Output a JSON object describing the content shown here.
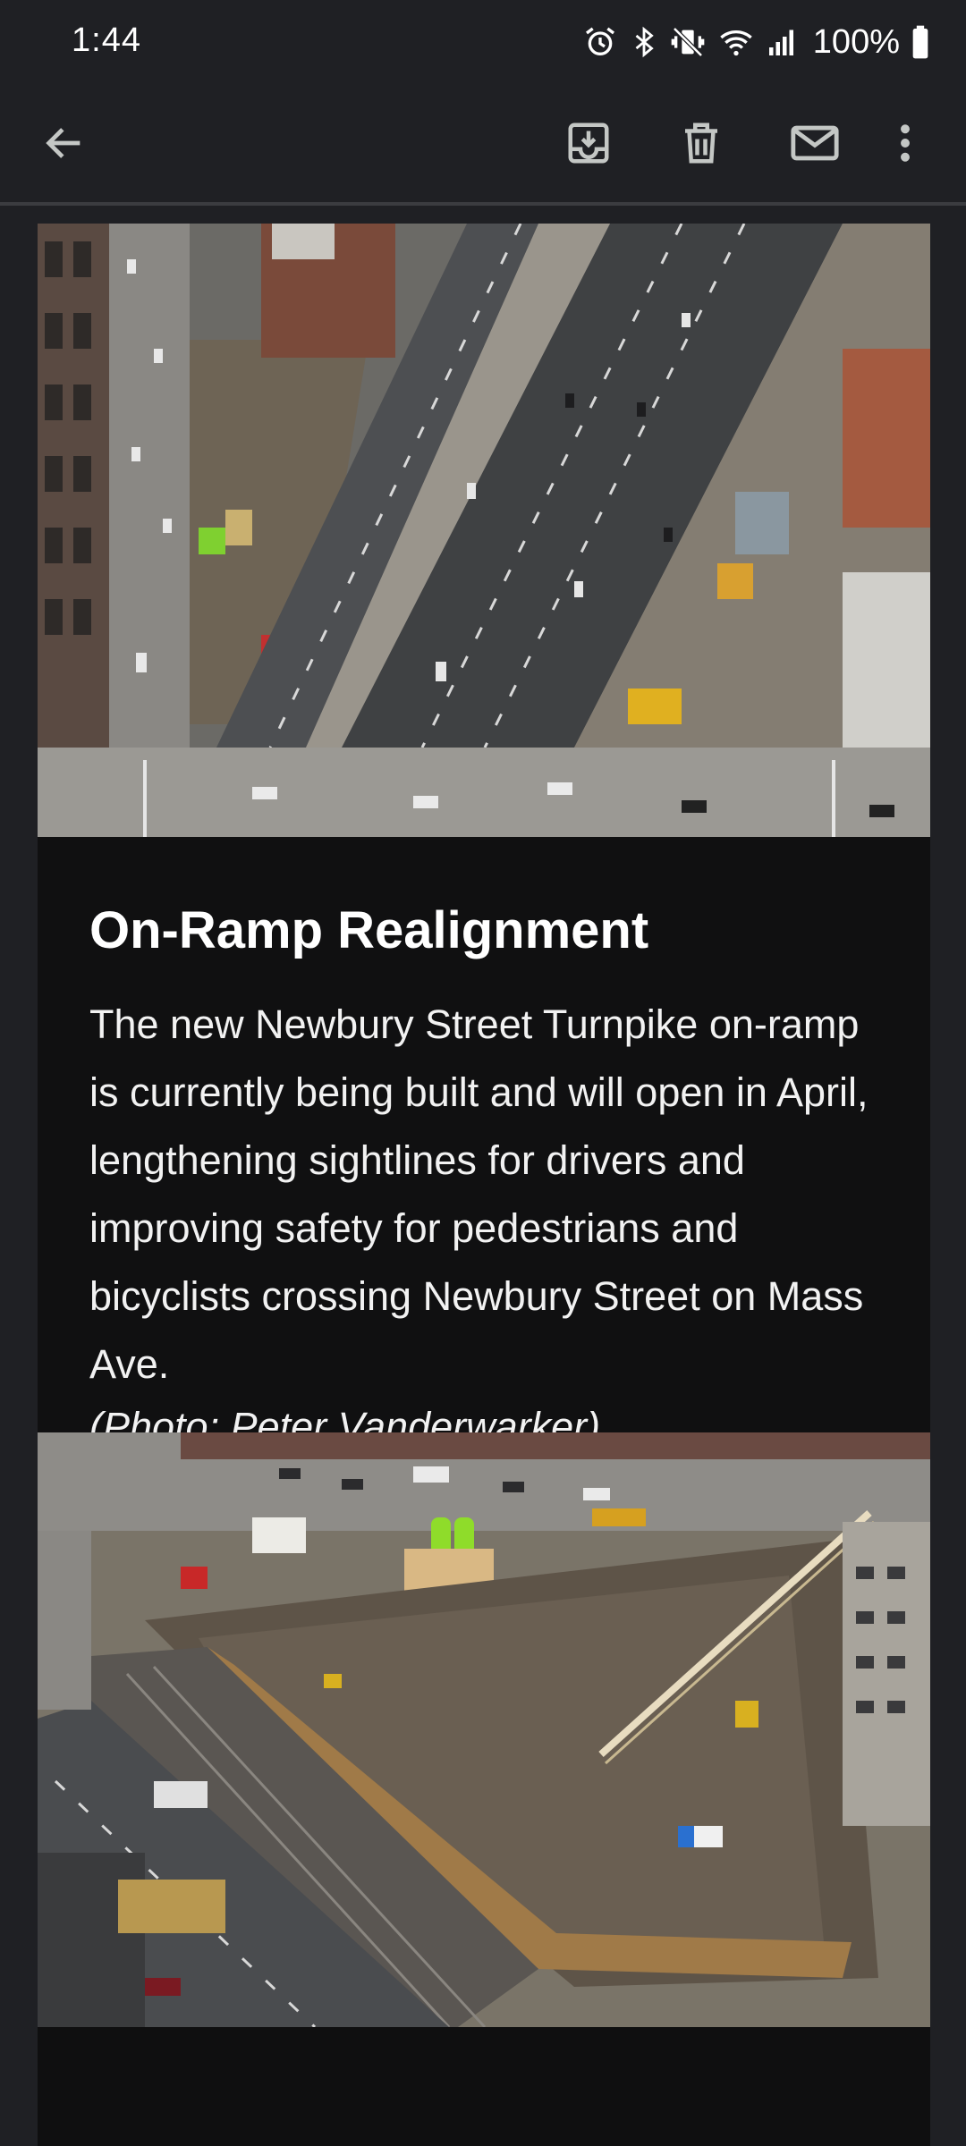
{
  "status_bar": {
    "time": "1:44",
    "battery": "100%",
    "icons": [
      "alarm-icon",
      "bluetooth-icon",
      "vibrate-icon",
      "wifi-icon",
      "signal-icon",
      "battery-icon"
    ]
  },
  "toolbar": {
    "icons": [
      "back-arrow-icon",
      "archive-icon",
      "delete-icon",
      "mark-unread-icon",
      "more-options-icon"
    ]
  },
  "email": {
    "article": {
      "title": "On-Ramp Realignment",
      "body": "The new Newbury Street Turnpike on-ramp is currently being built and will open in April, lengthening sightlines for drivers and improving safety for pedestrians and bicyclists crossing Newbury Street on Mass Ave.",
      "credit": "(Photo: Peter Vanderwarker)"
    }
  },
  "colors": {
    "background": "#1f2024",
    "content_background": "#101011",
    "text": "#ffffff",
    "icon": "#c4c7c5"
  }
}
